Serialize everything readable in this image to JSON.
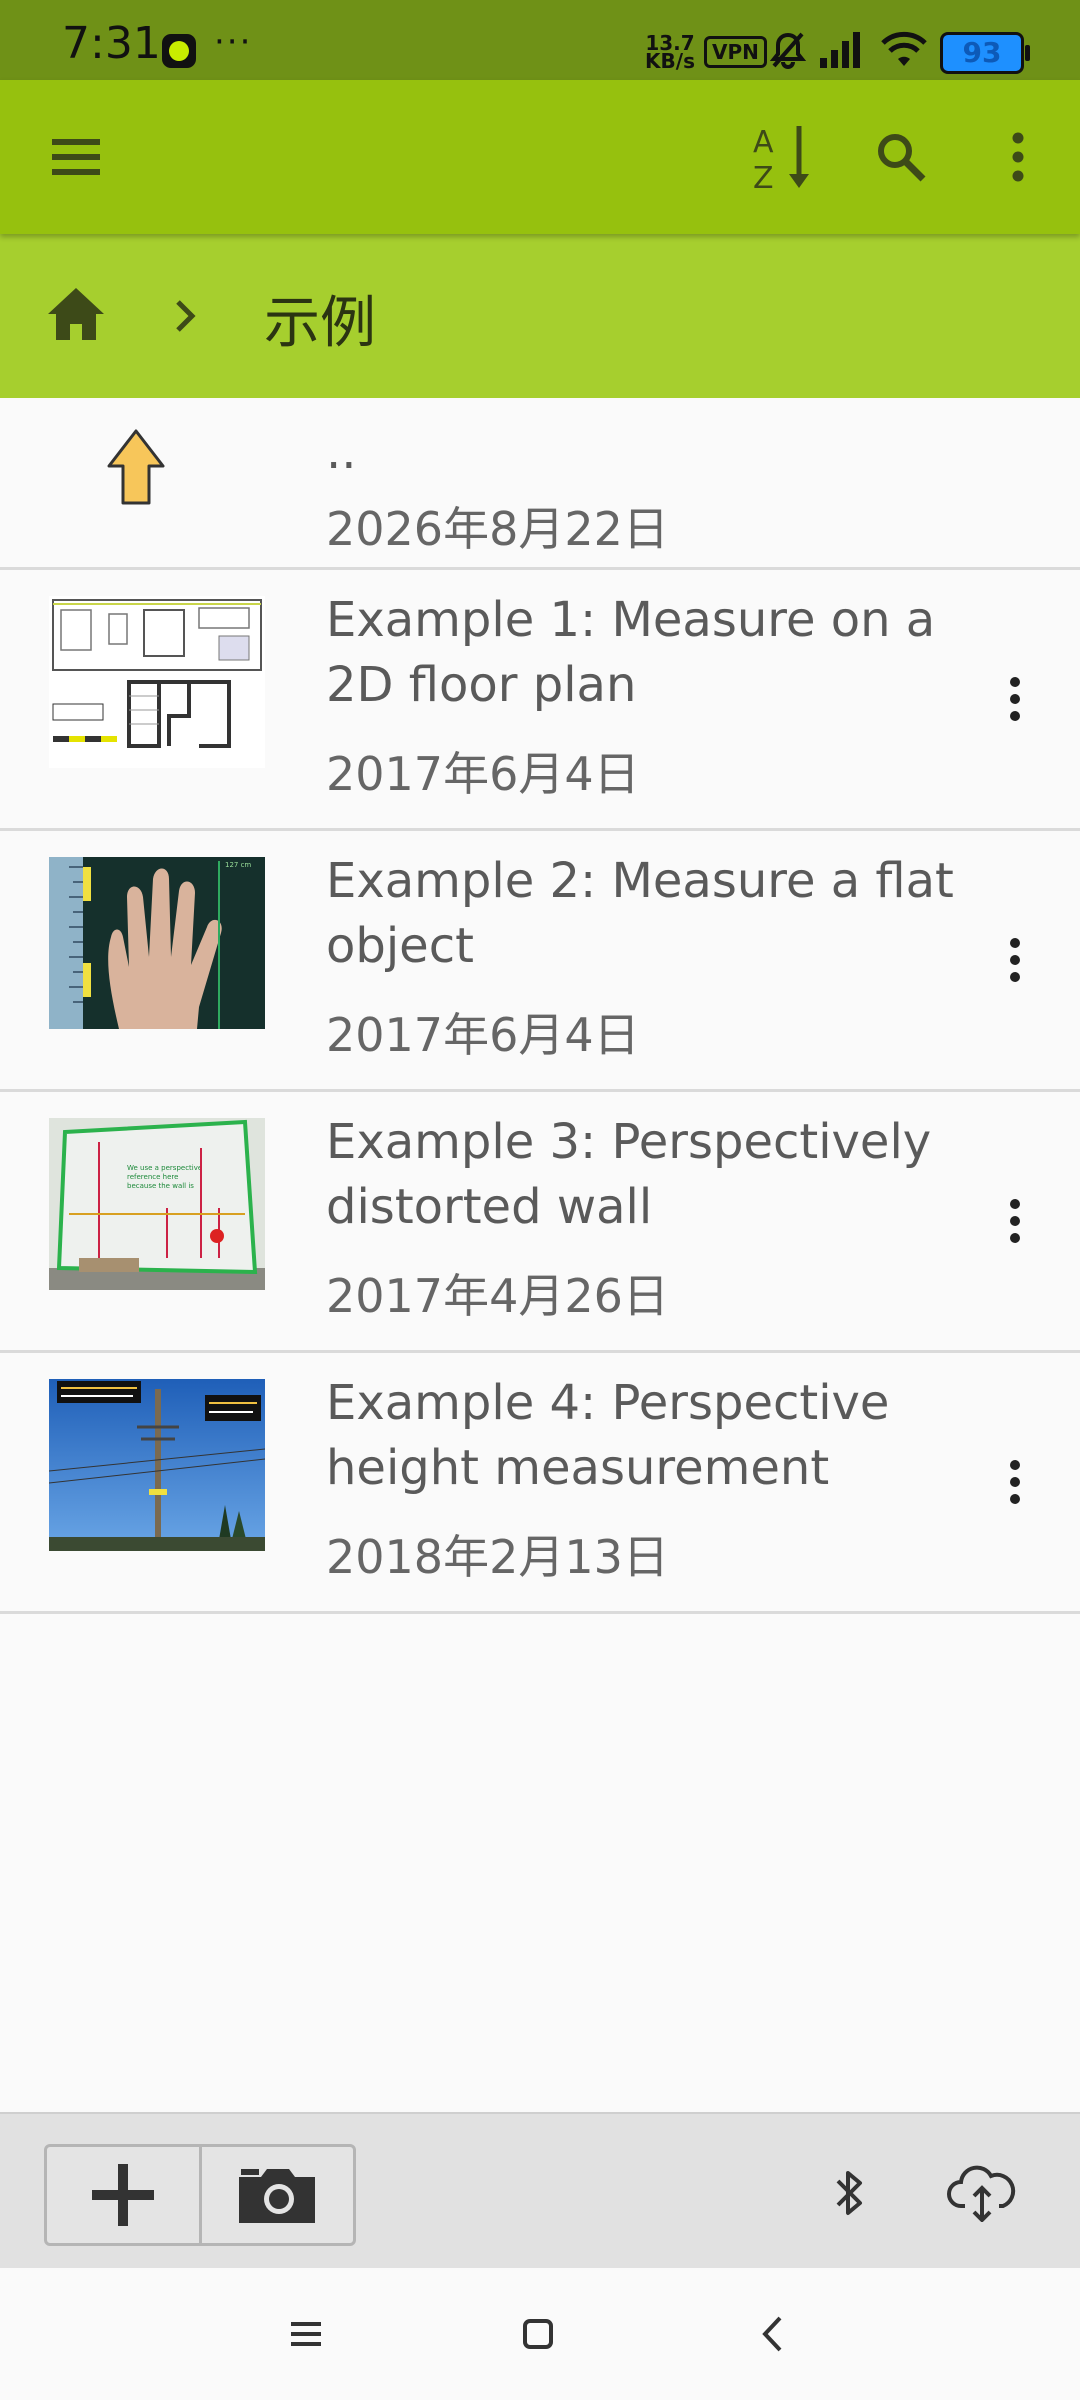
{
  "status_bar": {
    "time": "7:31",
    "dots": "···",
    "net_speed_value": "13.7",
    "net_speed_unit": "KB/s",
    "vpn": "VPN",
    "battery": "93"
  },
  "app_bar": {
    "menu_icon": "hamburger-menu-icon",
    "sort_icon": "sort-az-icon",
    "search_icon": "search-icon",
    "more_icon": "more-vertical-icon"
  },
  "breadcrumb": {
    "home_icon": "home-icon",
    "separator_icon": "chevron-right-icon",
    "current": "示例"
  },
  "parent_row": {
    "name": "..",
    "date": "2026年8月22日"
  },
  "items": [
    {
      "title": "Example 1: Measure on a 2D floor plan",
      "date": "2017年6月4日"
    },
    {
      "title": "Example 2: Measure a flat object",
      "date": "2017年6月4日"
    },
    {
      "title": "Example 3: Perspectively distorted wall",
      "date": "2017年4月26日"
    },
    {
      "title": "Example 4: Perspective height measurement",
      "date": "2018年2月13日"
    }
  ],
  "bottom_bar": {
    "add_icon": "plus-icon",
    "camera_icon": "camera-icon",
    "bluetooth_icon": "bluetooth-icon",
    "cloud_icon": "cloud-sync-icon"
  },
  "colors": {
    "status_bar": "#6f9117",
    "app_bar": "#96c10e",
    "breadcrumb_bar": "#a6cf2e",
    "up_arrow": "#f7c65a"
  }
}
